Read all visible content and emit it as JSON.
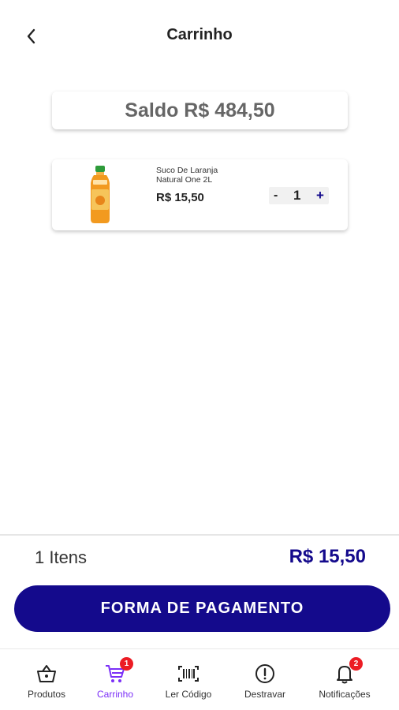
{
  "header": {
    "title": "Carrinho",
    "back_icon": "chevron-left-icon"
  },
  "balance": {
    "text": "Saldo R$ 484,50"
  },
  "cart": {
    "items": [
      {
        "name": "Suco De Laranja Natural One 2L",
        "price": "R$ 15,50",
        "quantity": "1",
        "minus_label": "-",
        "plus_label": "+",
        "image_icon": "orange-juice-bottle"
      }
    ]
  },
  "summary": {
    "count": "1 Itens",
    "total": "R$ 15,50"
  },
  "pay_button": {
    "label": "FORMA DE PAGAMENTO"
  },
  "tabbar": {
    "tabs": [
      {
        "label": "Produtos",
        "icon": "basket-icon"
      },
      {
        "label": "Carrinho",
        "icon": "cart-icon",
        "badge": "1"
      },
      {
        "label": "Ler Código",
        "icon": "barcode-icon"
      },
      {
        "label": "Destravar",
        "icon": "alert-circle-icon"
      },
      {
        "label": "Notificações",
        "icon": "bell-icon",
        "badge": "2"
      }
    ]
  },
  "colors": {
    "primary": "#140a8c",
    "active_tab": "#7b2ff7",
    "badge": "#ec1c24",
    "balance_text": "#666666"
  }
}
